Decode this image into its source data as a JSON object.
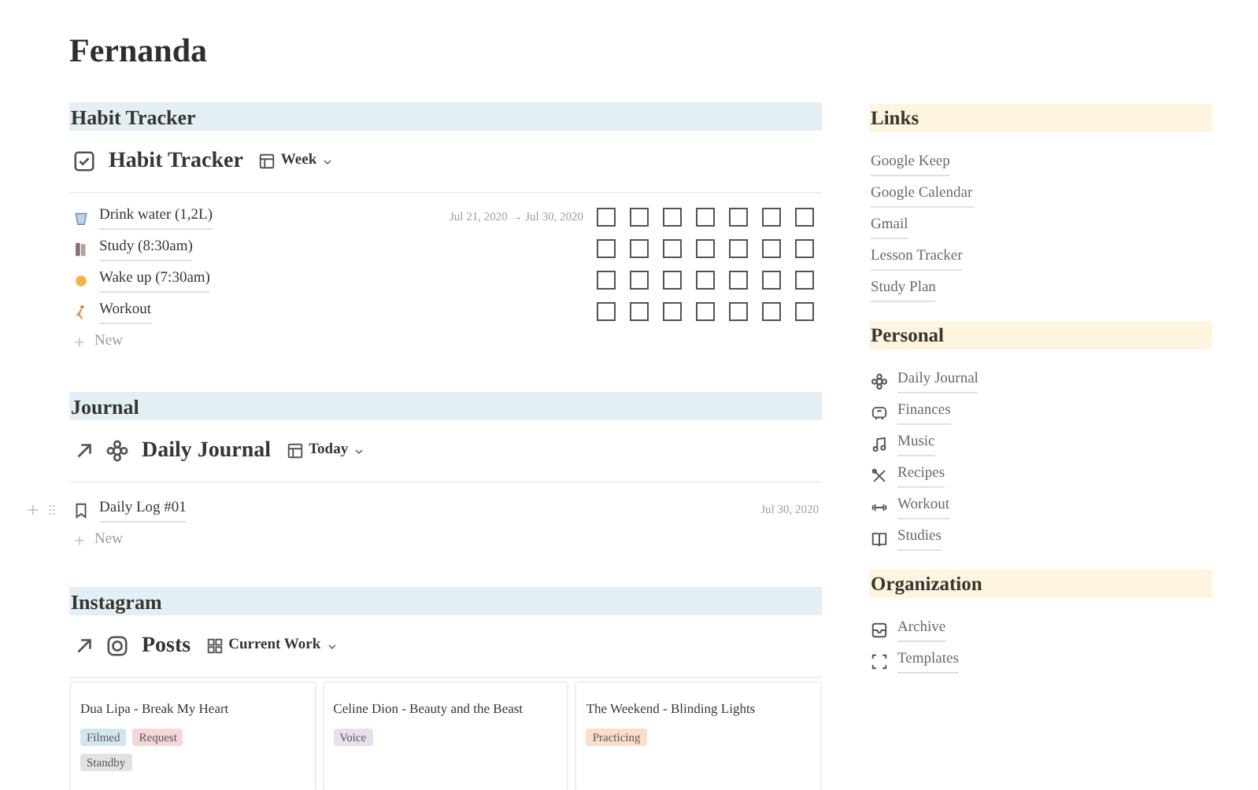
{
  "title": "Fernanda",
  "habit_section": {
    "heading": "Habit Tracker",
    "database": {
      "title": "Habit Tracker",
      "view": "Week",
      "date_range": "Jul 21, 2020 → Jul 30, 2020",
      "rows": [
        {
          "name": "Drink water (1,2L)",
          "days": [
            false,
            false,
            false,
            false,
            false,
            false,
            false
          ]
        },
        {
          "name": "Study (8:30am)",
          "days": [
            false,
            false,
            false,
            false,
            false,
            false,
            false
          ]
        },
        {
          "name": "Wake up (7:30am)",
          "days": [
            false,
            false,
            false,
            false,
            false,
            false,
            false
          ]
        },
        {
          "name": "Workout",
          "days": [
            false,
            false,
            false,
            false,
            false,
            false,
            false
          ]
        }
      ],
      "new_label": "New"
    }
  },
  "journal_section": {
    "heading": "Journal",
    "database": {
      "title": "Daily Journal",
      "view": "Today",
      "rows": [
        {
          "name": "Daily Log #01",
          "date": "Jul 30, 2020"
        }
      ],
      "new_label": "New"
    }
  },
  "instagram_section": {
    "heading": "Instagram",
    "database": {
      "title": "Posts",
      "view": "Current Work",
      "cards": [
        {
          "title": "Dua Lipa - Break My Heart",
          "tags": [
            {
              "label": "Filmed",
              "color": "#d3e5ef"
            },
            {
              "label": "Request",
              "color": "#f5d6d9"
            },
            {
              "label": "Standby",
              "color": "#e3e2e0"
            }
          ]
        },
        {
          "title": "Celine Dion - Beauty and the Beast",
          "tags": [
            {
              "label": "Voice",
              "color": "#e8deee"
            }
          ]
        },
        {
          "title": "The Weekend - Blinding Lights",
          "tags": [
            {
              "label": "Practicing",
              "color": "#fadec9"
            }
          ]
        }
      ]
    }
  },
  "sidebar": [
    {
      "heading": "Links",
      "items": [
        {
          "label": "Google Keep"
        },
        {
          "label": "Google Calendar"
        },
        {
          "label": "Gmail"
        },
        {
          "label": "Lesson Tracker"
        },
        {
          "label": "Study Plan"
        }
      ]
    },
    {
      "heading": "Personal",
      "items": [
        {
          "label": "Daily Journal"
        },
        {
          "label": "Finances"
        },
        {
          "label": "Music"
        },
        {
          "label": "Recipes"
        },
        {
          "label": "Workout"
        },
        {
          "label": "Studies"
        }
      ]
    },
    {
      "heading": "Organization",
      "items": [
        {
          "label": "Archive"
        },
        {
          "label": "Templates"
        }
      ]
    }
  ]
}
